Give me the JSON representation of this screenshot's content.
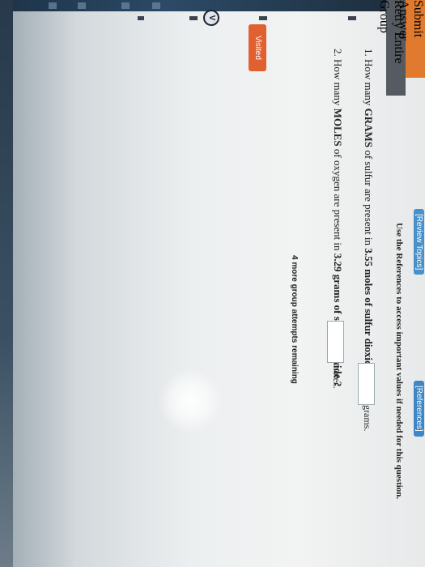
{
  "header": {
    "review_topics_label": "[Review Topics]",
    "references_label": "[References]",
    "note": "Use the References to access important values if needed for this question."
  },
  "questions": [
    {
      "number": "1.",
      "pre": "How many",
      "emph": "GRAMS",
      "mid": "of sulfur are present in",
      "amount": "3.55",
      "post": "moles of sulfur dioxide ?",
      "answer_value": "",
      "unit": "grams."
    },
    {
      "number": "2.",
      "pre": "How many",
      "emph": "MOLES",
      "mid": "of oxygen are present in",
      "amount": "3.29",
      "post": "grams of sulfur dioxide ?",
      "answer_value": "",
      "unit": "moles."
    }
  ],
  "actions": {
    "submit_label": "Submit Answer",
    "retry_label": "Retry Entire Group",
    "attempts_text": "4 more group attempts remaining"
  },
  "nav": {
    "visited_label": "Visited",
    "v_label": "V"
  },
  "colors": {
    "submit": "#e07a2e",
    "retry": "#555b60",
    "visited": "#e06030",
    "link": "#4a90c8"
  }
}
